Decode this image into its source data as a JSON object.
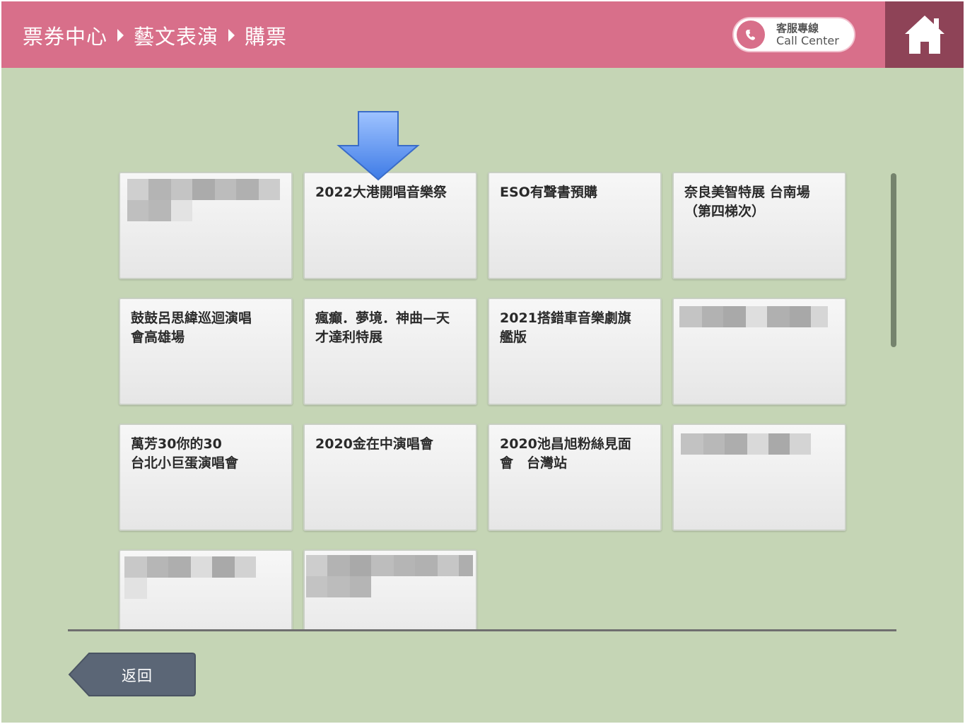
{
  "header": {
    "breadcrumb": [
      "票券中心",
      "藝文表演",
      "購票"
    ],
    "call_center_zh": "客服專線",
    "call_center_en": "Call Center"
  },
  "events": [
    {
      "title": ""
    },
    {
      "title": "2022大港開唱音樂祭"
    },
    {
      "title": "ESO有聲書預購"
    },
    {
      "title": "奈良美智特展 台南場\n（第四梯次）"
    },
    {
      "title": "鼓鼓呂思緯巡迴演唱\n會高雄場"
    },
    {
      "title": "瘋癲．夢境．神曲—天\n才達利特展"
    },
    {
      "title": "2021搭錯車音樂劇旗\n艦版"
    },
    {
      "title": ""
    },
    {
      "title": "萬芳30你的30\n台北小巨蛋演唱會"
    },
    {
      "title": "2020金在中演唱會"
    },
    {
      "title": "2020池昌旭粉絲見面\n會　台灣站"
    },
    {
      "title": ""
    },
    {
      "title": ""
    },
    {
      "title": ""
    }
  ],
  "footer": {
    "back_label": "返回"
  },
  "colors": {
    "header": "#d86f8a",
    "home_bg": "#8e4357",
    "background": "#c5d5b5",
    "back_button": "#5b6676",
    "arrow": "#5b8ff0"
  },
  "icons": {
    "home": "home-icon",
    "phone": "phone-icon",
    "pointer": "arrow-down-icon"
  }
}
